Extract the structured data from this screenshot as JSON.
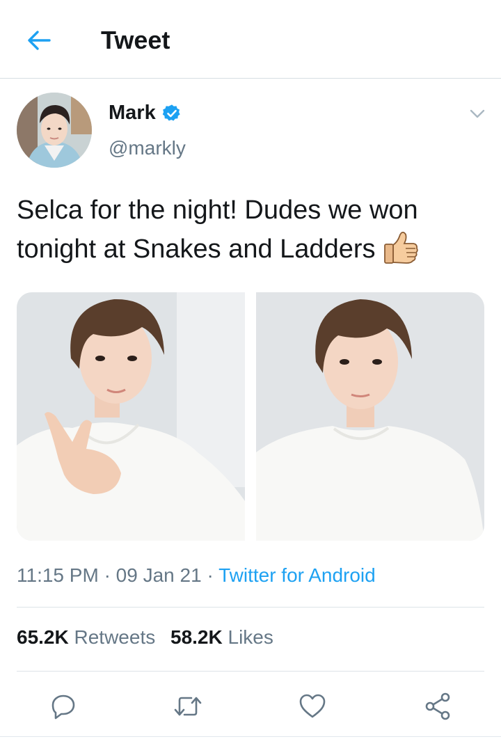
{
  "header": {
    "title": "Tweet",
    "back_icon": "arrow-left-icon"
  },
  "colors": {
    "accent": "#1da1f2",
    "text": "#14171a",
    "secondary": "#657786"
  },
  "author": {
    "name": "Mark",
    "handle": "@markly",
    "verified_icon": "verified-badge-icon"
  },
  "tweet": {
    "text_line1": "Selca for the night! Dudes we won",
    "text_line2": "tonight at Snakes and Ladders",
    "emoji_icon": "thumbs-up-icon",
    "time": "11:15 PM",
    "date": "09 Jan 21",
    "separator": "·",
    "source": "Twitter for Android"
  },
  "stats": {
    "retweets_count": "65.2K",
    "retweets_label": "Retweets",
    "likes_count": "58.2K",
    "likes_label": "Likes"
  },
  "actions": [
    "reply-icon",
    "retweet-icon",
    "like-icon",
    "share-icon"
  ]
}
